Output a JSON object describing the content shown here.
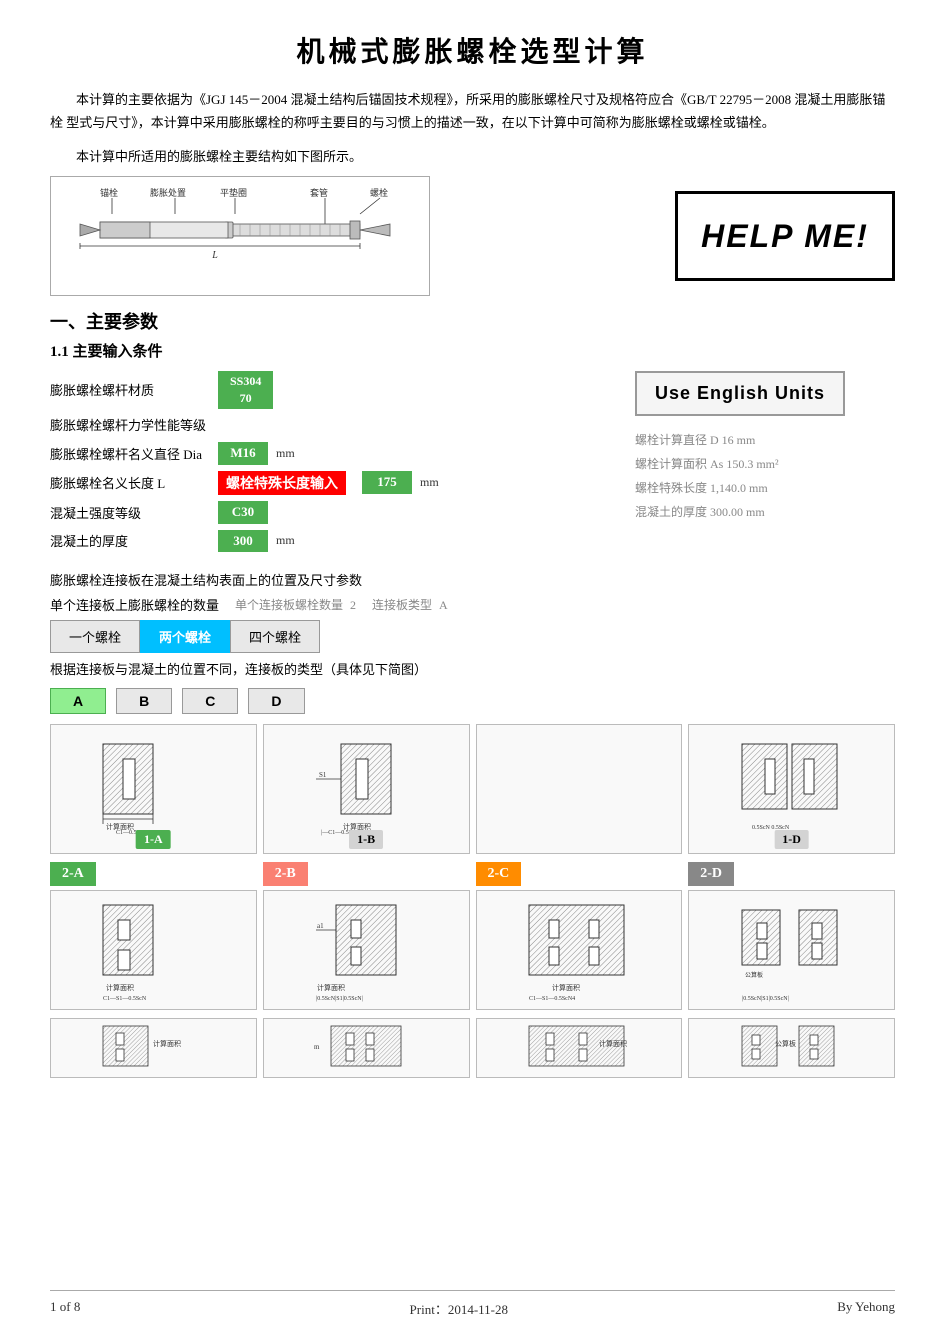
{
  "title": "机械式膨胀螺栓选型计算",
  "intro": [
    "本计算的主要依据为《JGJ 145－2004 混凝土结构后锚固技术规程》，所采用的膨胀螺栓尺寸及规格符应合《GB/T 22795－2008 混凝土用膨胀锚栓 型式与尺寸》，本计算中采用膨胀螺栓的称呼主要目的与习惯上的描述一致，在以下计算中可简称为膨胀螺栓或螺栓或锚栓。",
    "本计算中所适用的膨胀螺栓主要结构如下图所示。"
  ],
  "help_me": "HELP ME!",
  "section1": "一、主要参数",
  "subsection1": "1.1 主要输入条件",
  "params": {
    "material_label": "膨胀螺栓螺杆材质",
    "material_value1": "SS304",
    "material_value2": "70",
    "grade_label": "膨胀螺栓螺杆力学性能等级",
    "diameter_label": "膨胀螺栓螺杆名义直径 Dia",
    "diameter_value": "M16",
    "diameter_unit": "mm",
    "length_label": "膨胀螺栓名义长度  L",
    "length_special": "螺栓特殊长度输入",
    "length_value": "175",
    "length_unit": "mm",
    "concrete_grade_label": "混凝土强度等级",
    "concrete_grade_value": "C30",
    "concrete_thick_label": "混凝土的厚度",
    "concrete_thick_value": "300",
    "concrete_thick_unit": "mm"
  },
  "right_params": {
    "calc_dia_label": "螺栓计算直径 D",
    "calc_dia_value": "16",
    "calc_dia_unit": "mm",
    "calc_area_label": "螺栓计算面积 As",
    "calc_area_value": "150.3",
    "calc_area_unit": "mm²",
    "special_len_label": "螺栓特殊长度",
    "special_len_value": "1,140.0",
    "special_len_unit": "mm",
    "concrete_thick_label": "混凝土的厚度",
    "concrete_thick_value": "300.00",
    "concrete_thick_unit": "mm"
  },
  "use_english_btn": "Use  English  Units",
  "bolt_section": {
    "desc": "膨胀螺栓连接板在混凝土结构表面上的位置及尺寸参数",
    "count_label": "单个连接板上膨胀螺栓的数量",
    "count_right_label": "单个连接板螺栓数量",
    "count_right_value": "2",
    "type_right_label": "连接板类型",
    "type_right_value": "A",
    "buttons": [
      "一个螺栓",
      "两个螺栓",
      "四个螺栓"
    ],
    "active_button": 1,
    "position_note": "根据连接板与混凝土的位置不同，连接板的类型（具体见下简图）"
  },
  "type_buttons": [
    "A",
    "B",
    "C",
    "D"
  ],
  "active_type": 0,
  "diagram_labels_row1": [
    "1-A",
    "1-B",
    "",
    "1-D"
  ],
  "diagram_labels_row2_title": [
    "2-A",
    "2-B",
    "2-C",
    "2-D"
  ],
  "footer": {
    "page": "1 of 8",
    "print": "Print：2014-11-28",
    "author": "By Yehong"
  }
}
